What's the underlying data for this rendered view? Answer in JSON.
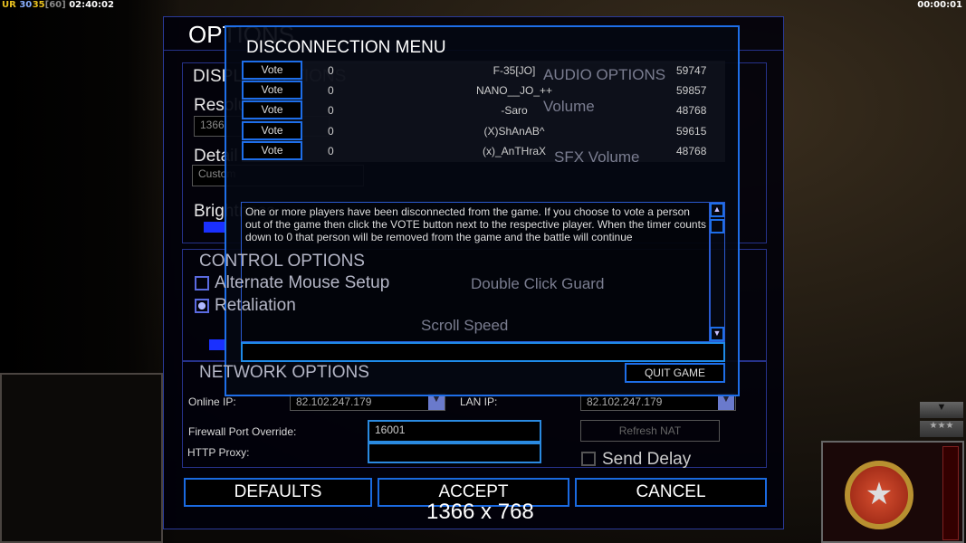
{
  "hud": {
    "prefix": "UR",
    "stat1": "30",
    "stat2": "35",
    "bracket": "[60]",
    "clock": "02:40:02",
    "timer": "00:00:01"
  },
  "options": {
    "title": "OPTIONS",
    "display_title": "DISPLAY OPTIONS",
    "resolution_label": "Resolution",
    "resolution_value": "1366",
    "detail_label": "Detail",
    "detail_value": "Custom",
    "brightness_label": "Brightness",
    "audio_title": "AUDIO OPTIONS",
    "volume_label": "Volume",
    "sfx_volume_label": "SFX Volume",
    "control_title": "CONTROL OPTIONS",
    "alt_mouse_label": "Alternate Mouse Setup",
    "retaliation_label": "Retaliation",
    "double_click_label": "Double Click Guard",
    "scroll_speed_label": "Scroll Speed",
    "network_title": "NETWORK OPTIONS",
    "online_ip_label": "Online IP:",
    "online_ip_value": "82.102.247.179",
    "lan_ip_label": "LAN IP:",
    "lan_ip_value": "82.102.247.179",
    "firewall_label": "Firewall Port Override:",
    "firewall_value": "16001",
    "proxy_label": "HTTP Proxy:",
    "proxy_value": "",
    "refresh_nat": "Refresh NAT",
    "send_delay": "Send Delay",
    "defaults": "DEFAULTS",
    "accept": "ACCEPT",
    "cancel": "CANCEL",
    "resolution_overlay": "1366 x 768"
  },
  "dialog": {
    "title": "DISCONNECTION MENU",
    "vote_label": "Vote",
    "players": [
      {
        "votes": "0",
        "name": "F-35[JO]",
        "ping": "59747"
      },
      {
        "votes": "0",
        "name": "NANO__JO_++",
        "ping": "59857"
      },
      {
        "votes": "0",
        "name": "-Saro",
        "ping": "48768"
      },
      {
        "votes": "0",
        "name": "(X)ShAnAB^",
        "ping": "59615"
      },
      {
        "votes": "0",
        "name": "(x)_AnTHraX",
        "ping": "48768"
      }
    ],
    "message": "One or more players have been disconnected from the game. If you choose to vote a person out of the game then click the VOTE button next to the respective player. When the timer counts down to 0 that person will be removed from the game and the battle will continue",
    "chat_input": "",
    "quit": "QUIT GAME"
  },
  "colors": {
    "accent": "#1e6ee8",
    "hud_yellow": "#e8c020",
    "hud_blue": "#8ab0ff"
  }
}
